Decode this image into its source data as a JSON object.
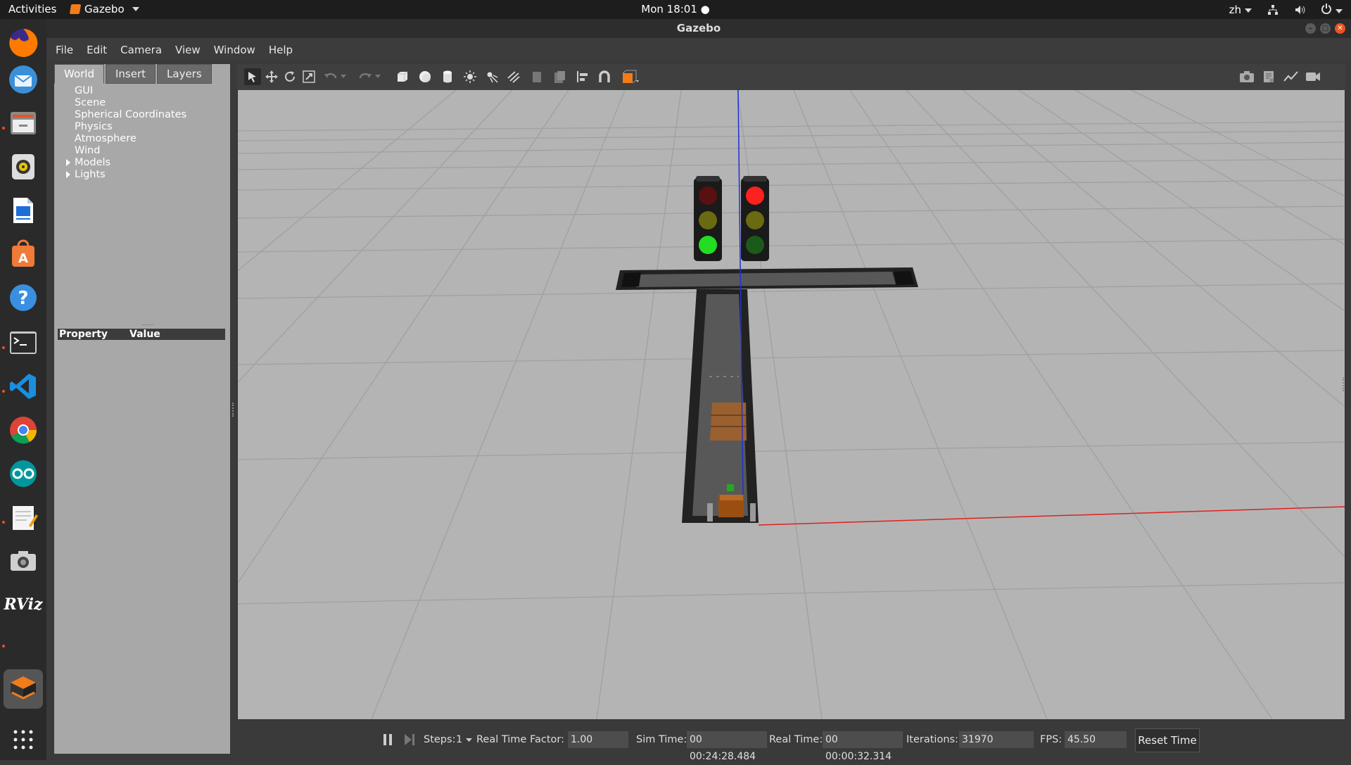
{
  "topbar": {
    "activities": "Activities",
    "app_name": "Gazebo",
    "clock": "Mon 18:01 ●",
    "lang": "zh"
  },
  "dock": {
    "items": [
      {
        "name": "firefox",
        "color": "#e66000"
      },
      {
        "name": "thunderbird",
        "color": "#2a6fb5"
      },
      {
        "name": "files",
        "color": "#6d6d6d"
      },
      {
        "name": "rhythmbox",
        "color": "#c7a400"
      },
      {
        "name": "libreoffice-writer",
        "color": "#1e5fb3"
      },
      {
        "name": "software-center",
        "color": "#e95420"
      },
      {
        "name": "help",
        "color": "#2d7cd1"
      },
      {
        "name": "terminal",
        "color": "#2b2b2b"
      },
      {
        "name": "vscode",
        "color": "#0a78d1"
      },
      {
        "name": "chrome",
        "color": "#db4437"
      },
      {
        "name": "arduino",
        "color": "#00979c"
      },
      {
        "name": "text-editor",
        "color": "#e8e8e8"
      },
      {
        "name": "screenshot",
        "color": "#777777"
      },
      {
        "name": "rviz",
        "color": "#2a2a2a",
        "label": "RViz"
      },
      {
        "name": "gazebo",
        "color": "#555555"
      },
      {
        "name": "show-apps",
        "color": "#2a2a2a"
      }
    ]
  },
  "window": {
    "title": "Gazebo",
    "menu": [
      "File",
      "Edit",
      "Camera",
      "View",
      "Window",
      "Help"
    ]
  },
  "left_panel": {
    "tabs": [
      "World",
      "Insert",
      "Layers"
    ],
    "tree": [
      "GUI",
      "Scene",
      "Spherical Coordinates",
      "Physics",
      "Atmosphere",
      "Wind",
      "Models",
      "Lights"
    ],
    "property_header": {
      "property": "Property",
      "value": "Value"
    }
  },
  "toolbar": {
    "tools": [
      "select-mode",
      "translate-mode",
      "rotate-mode",
      "scale-mode",
      "undo",
      "undo-dropdown",
      "redo",
      "redo-dropdown",
      "box-shape",
      "sphere-shape",
      "cylinder-shape",
      "point-light",
      "spot-light",
      "directional-light",
      "copy",
      "paste",
      "align",
      "snap",
      "change-view"
    ],
    "right_tools": [
      "screenshot",
      "log",
      "plot",
      "record-video"
    ]
  },
  "bottom_bar": {
    "steps_label": "Steps:",
    "steps_value": "1",
    "rtf_label": "Real Time Factor:",
    "rtf_value": "1.00",
    "sim_time_label": "Sim Time:",
    "sim_time_value": "00 00:24:28.484",
    "real_time_label": "Real Time:",
    "real_time_value": "00 00:00:32.314",
    "iterations_label": "Iterations:",
    "iterations_value": "31970",
    "fps_label": "FPS:",
    "fps_value": "45.50",
    "reset_time": "Reset Time"
  },
  "colors": {
    "accent": "#e95420",
    "viewport_bg": "#b4b4b4",
    "traffic_red": "#ff2020",
    "traffic_green": "#22dd22"
  }
}
